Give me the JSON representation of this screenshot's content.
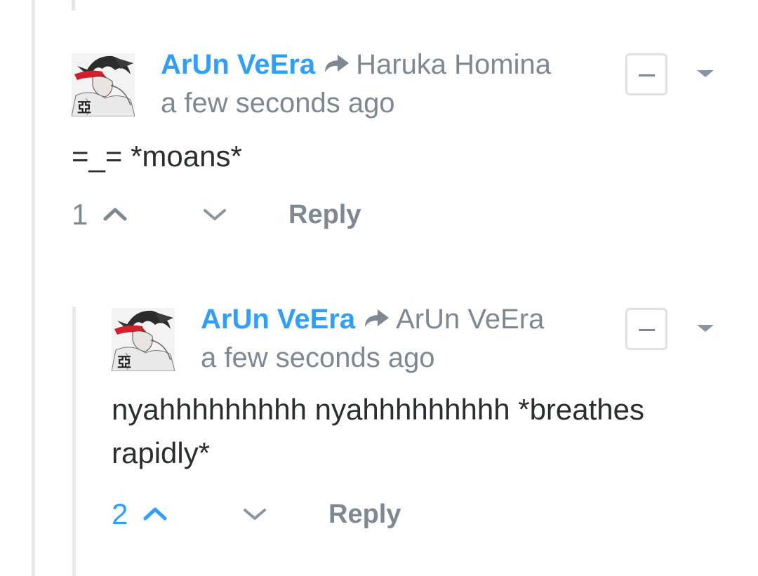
{
  "comments": [
    {
      "author": "ArUn VeEra",
      "reply_to": "Haruka Homina",
      "timestamp": "a few seconds ago",
      "text": "=_= *moans*",
      "votes": "1",
      "vote_state": "neutral",
      "reply_label": "Reply",
      "avatar_caption": "亞"
    },
    {
      "author": "ArUn VeEra",
      "reply_to": "ArUn VeEra",
      "timestamp": "a few seconds ago",
      "text": "nyahhhhhhhhh nyahhhhhhhhh *breathes rapidly*",
      "votes": "2",
      "vote_state": "upvoted",
      "reply_label": "Reply",
      "avatar_caption": "亞"
    }
  ],
  "colors": {
    "author": "#2e9fff",
    "muted": "#7d8893",
    "body": "#2a2e2e",
    "upvoted": "#2e9fff",
    "thread_line": "#e6e8ea"
  },
  "icons": {
    "reply_to": "share-arrow-icon",
    "collapse": "minus-icon",
    "menu": "caret-down-icon",
    "upvote": "chevron-up-icon",
    "downvote": "chevron-down-icon"
  }
}
